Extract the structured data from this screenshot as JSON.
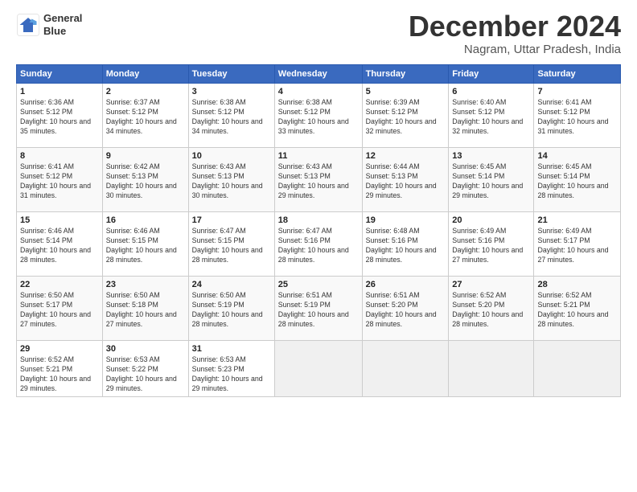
{
  "header": {
    "logo": {
      "line1": "General",
      "line2": "Blue"
    },
    "title": "December 2024",
    "subtitle": "Nagram, Uttar Pradesh, India"
  },
  "weekdays": [
    "Sunday",
    "Monday",
    "Tuesday",
    "Wednesday",
    "Thursday",
    "Friday",
    "Saturday"
  ],
  "weeks": [
    [
      {
        "day": "1",
        "sunrise": "6:36 AM",
        "sunset": "5:12 PM",
        "daylight": "10 hours and 35 minutes."
      },
      {
        "day": "2",
        "sunrise": "6:37 AM",
        "sunset": "5:12 PM",
        "daylight": "10 hours and 34 minutes."
      },
      {
        "day": "3",
        "sunrise": "6:38 AM",
        "sunset": "5:12 PM",
        "daylight": "10 hours and 34 minutes."
      },
      {
        "day": "4",
        "sunrise": "6:38 AM",
        "sunset": "5:12 PM",
        "daylight": "10 hours and 33 minutes."
      },
      {
        "day": "5",
        "sunrise": "6:39 AM",
        "sunset": "5:12 PM",
        "daylight": "10 hours and 32 minutes."
      },
      {
        "day": "6",
        "sunrise": "6:40 AM",
        "sunset": "5:12 PM",
        "daylight": "10 hours and 32 minutes."
      },
      {
        "day": "7",
        "sunrise": "6:41 AM",
        "sunset": "5:12 PM",
        "daylight": "10 hours and 31 minutes."
      }
    ],
    [
      {
        "day": "8",
        "sunrise": "6:41 AM",
        "sunset": "5:12 PM",
        "daylight": "10 hours and 31 minutes."
      },
      {
        "day": "9",
        "sunrise": "6:42 AM",
        "sunset": "5:13 PM",
        "daylight": "10 hours and 30 minutes."
      },
      {
        "day": "10",
        "sunrise": "6:43 AM",
        "sunset": "5:13 PM",
        "daylight": "10 hours and 30 minutes."
      },
      {
        "day": "11",
        "sunrise": "6:43 AM",
        "sunset": "5:13 PM",
        "daylight": "10 hours and 29 minutes."
      },
      {
        "day": "12",
        "sunrise": "6:44 AM",
        "sunset": "5:13 PM",
        "daylight": "10 hours and 29 minutes."
      },
      {
        "day": "13",
        "sunrise": "6:45 AM",
        "sunset": "5:14 PM",
        "daylight": "10 hours and 29 minutes."
      },
      {
        "day": "14",
        "sunrise": "6:45 AM",
        "sunset": "5:14 PM",
        "daylight": "10 hours and 28 minutes."
      }
    ],
    [
      {
        "day": "15",
        "sunrise": "6:46 AM",
        "sunset": "5:14 PM",
        "daylight": "10 hours and 28 minutes."
      },
      {
        "day": "16",
        "sunrise": "6:46 AM",
        "sunset": "5:15 PM",
        "daylight": "10 hours and 28 minutes."
      },
      {
        "day": "17",
        "sunrise": "6:47 AM",
        "sunset": "5:15 PM",
        "daylight": "10 hours and 28 minutes."
      },
      {
        "day": "18",
        "sunrise": "6:47 AM",
        "sunset": "5:16 PM",
        "daylight": "10 hours and 28 minutes."
      },
      {
        "day": "19",
        "sunrise": "6:48 AM",
        "sunset": "5:16 PM",
        "daylight": "10 hours and 28 minutes."
      },
      {
        "day": "20",
        "sunrise": "6:49 AM",
        "sunset": "5:16 PM",
        "daylight": "10 hours and 27 minutes."
      },
      {
        "day": "21",
        "sunrise": "6:49 AM",
        "sunset": "5:17 PM",
        "daylight": "10 hours and 27 minutes."
      }
    ],
    [
      {
        "day": "22",
        "sunrise": "6:50 AM",
        "sunset": "5:17 PM",
        "daylight": "10 hours and 27 minutes."
      },
      {
        "day": "23",
        "sunrise": "6:50 AM",
        "sunset": "5:18 PM",
        "daylight": "10 hours and 27 minutes."
      },
      {
        "day": "24",
        "sunrise": "6:50 AM",
        "sunset": "5:19 PM",
        "daylight": "10 hours and 28 minutes."
      },
      {
        "day": "25",
        "sunrise": "6:51 AM",
        "sunset": "5:19 PM",
        "daylight": "10 hours and 28 minutes."
      },
      {
        "day": "26",
        "sunrise": "6:51 AM",
        "sunset": "5:20 PM",
        "daylight": "10 hours and 28 minutes."
      },
      {
        "day": "27",
        "sunrise": "6:52 AM",
        "sunset": "5:20 PM",
        "daylight": "10 hours and 28 minutes."
      },
      {
        "day": "28",
        "sunrise": "6:52 AM",
        "sunset": "5:21 PM",
        "daylight": "10 hours and 28 minutes."
      }
    ],
    [
      {
        "day": "29",
        "sunrise": "6:52 AM",
        "sunset": "5:21 PM",
        "daylight": "10 hours and 29 minutes."
      },
      {
        "day": "30",
        "sunrise": "6:53 AM",
        "sunset": "5:22 PM",
        "daylight": "10 hours and 29 minutes."
      },
      {
        "day": "31",
        "sunrise": "6:53 AM",
        "sunset": "5:23 PM",
        "daylight": "10 hours and 29 minutes."
      },
      null,
      null,
      null,
      null
    ]
  ]
}
